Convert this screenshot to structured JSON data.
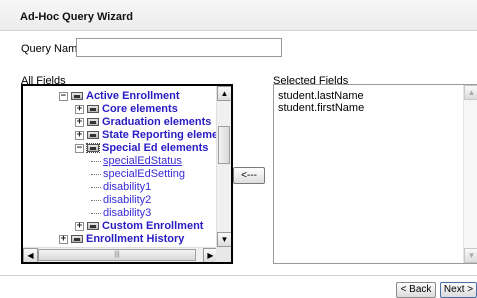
{
  "wizard": {
    "title": "Ad-Hoc Query Wizard"
  },
  "query": {
    "label": "Query Name:",
    "value": "",
    "placeholder": ""
  },
  "all_fields": {
    "label": "All Fields",
    "items": [
      {
        "label": "Active Enrollment",
        "kind": "folder",
        "toggle": "−"
      },
      {
        "label": "Core elements",
        "kind": "folder",
        "toggle": "+"
      },
      {
        "label": "Graduation elements",
        "kind": "folder",
        "toggle": "+"
      },
      {
        "label": "State Reporting elements",
        "kind": "folder",
        "toggle": "+"
      },
      {
        "label": "Special Ed elements",
        "kind": "folder",
        "toggle": "−"
      },
      {
        "label": "specialEdStatus",
        "kind": "leaf"
      },
      {
        "label": "specialEdSetting",
        "kind": "leaf"
      },
      {
        "label": "disability1",
        "kind": "leaf"
      },
      {
        "label": "disability2",
        "kind": "leaf"
      },
      {
        "label": "disability3",
        "kind": "leaf"
      },
      {
        "label": "Custom Enrollment",
        "kind": "folder",
        "toggle": "+"
      },
      {
        "label": "Enrollment History",
        "kind": "folder",
        "toggle": "+"
      }
    ],
    "hscroll_grip": "|||"
  },
  "move_button": {
    "label": "<---"
  },
  "selected_fields": {
    "label": "Selected Fields",
    "items": [
      "student.lastName",
      "student.firstName"
    ]
  },
  "nav": {
    "back_label": "< Back",
    "next_label": "Next >"
  }
}
